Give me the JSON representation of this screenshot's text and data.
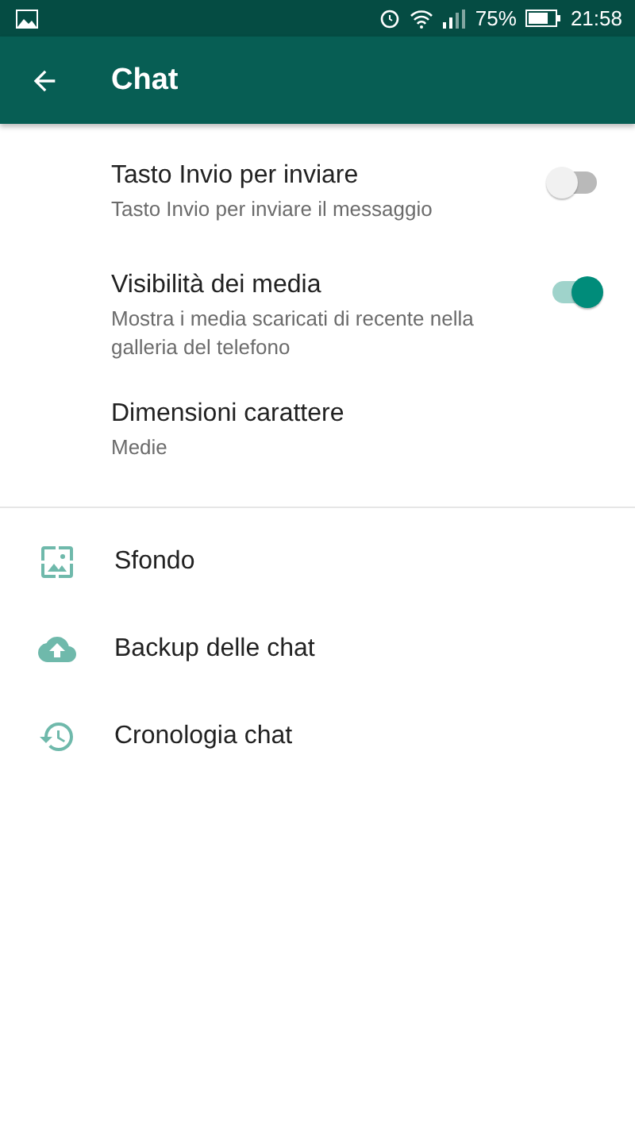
{
  "status_bar": {
    "battery": "75%",
    "time": "21:58"
  },
  "app_bar": {
    "title": "Chat"
  },
  "settings": [
    {
      "kind": "toggle",
      "title": "Tasto Invio per inviare",
      "subtitle": "Tasto Invio per inviare il messaggio",
      "on": false
    },
    {
      "kind": "toggle",
      "title": "Visibilità dei media",
      "subtitle": "Mostra i media scaricati di recente nella galleria del telefono",
      "on": true
    },
    {
      "kind": "plain",
      "title": "Dimensioni carattere",
      "subtitle": "Medie"
    }
  ],
  "links": [
    {
      "kind": "wallpaper",
      "label": "Sfondo"
    },
    {
      "kind": "cloud",
      "label": "Backup delle chat"
    },
    {
      "kind": "history",
      "label": "Cronologia chat"
    }
  ]
}
